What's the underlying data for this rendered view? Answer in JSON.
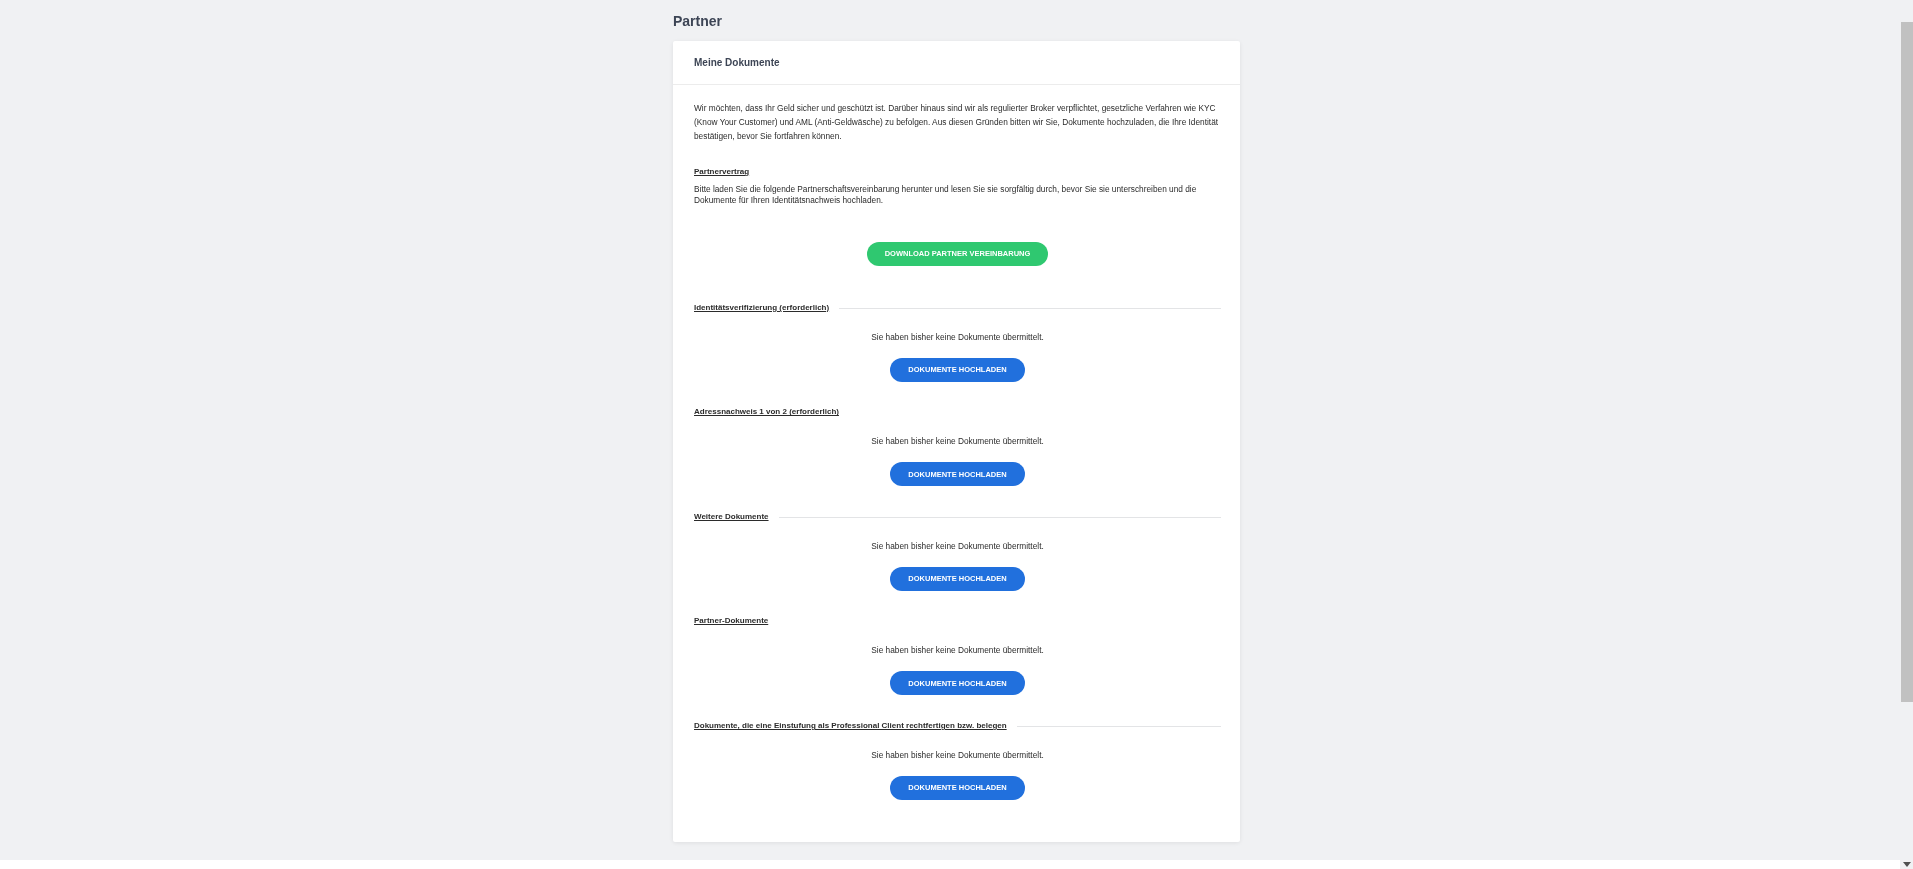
{
  "page_title": "Partner",
  "card": {
    "title": "Meine Dokumente",
    "intro": "Wir möchten, dass Ihr Geld sicher und geschützt ist. Darüber hinaus sind wir als regulierter Broker verpflichtet, gesetzliche Verfahren wie KYC (Know Your Customer) und AML (Anti-Geldwäsche) zu befolgen. Aus diesen Gründen bitten wir Sie, Dokumente hochzuladen, die Ihre Identität bestätigen, bevor Sie fortfahren können.",
    "agreement": {
      "heading": "Partnervertrag",
      "text": "Bitte laden Sie die folgende Partnerschaftsvereinbarung herunter und lesen Sie sie sorgfältig durch, bevor Sie sie unterschreiben und die Dokumente für Ihren Identitätsnachweis hochladen.",
      "button": "DOWNLOAD PARTNER VEREINBARUNG"
    },
    "sections": [
      {
        "heading": "Identitätsverifizierung (erforderlich)",
        "divider": true,
        "status": "Sie haben bisher keine Dokumente übermittelt.",
        "button": "DOKUMENTE HOCHLADEN"
      },
      {
        "heading": "Adressnachweis 1 von 2 (erforderlich)",
        "divider": false,
        "status": "Sie haben bisher keine Dokumente übermittelt.",
        "button": "DOKUMENTE HOCHLADEN"
      },
      {
        "heading": "Weitere Dokumente",
        "divider": true,
        "status": "Sie haben bisher keine Dokumente übermittelt.",
        "button": "DOKUMENTE HOCHLADEN"
      },
      {
        "heading": "Partner-Dokumente",
        "divider": false,
        "status": "Sie haben bisher keine Dokumente übermittelt.",
        "button": "DOKUMENTE HOCHLADEN"
      },
      {
        "heading": "Dokumente, die eine Einstufung als Professional Client rechtfertigen bzw. belegen",
        "divider": true,
        "status": "Sie haben bisher keine Dokumente übermittelt.",
        "button": "DOKUMENTE HOCHLADEN"
      }
    ]
  }
}
